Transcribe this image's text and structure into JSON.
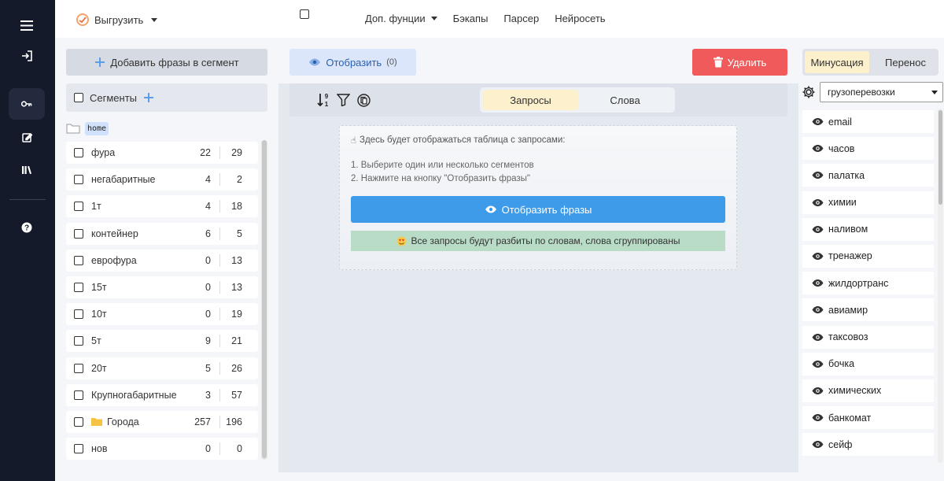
{
  "header": {
    "export_label": "Выгрузить",
    "nav": [
      "Доп. фунции",
      "Бэкапы",
      "Парсер",
      "Нейросеть"
    ]
  },
  "left": {
    "add_button": "Добавить фразы в сегмент",
    "segments_label": "Сегменты",
    "folder_tag": "home",
    "segments": [
      {
        "name": "фура",
        "a": "22",
        "b": "29",
        "folder": false
      },
      {
        "name": "негабаритные",
        "a": "4",
        "b": "2",
        "folder": false
      },
      {
        "name": "1т",
        "a": "4",
        "b": "18",
        "folder": false
      },
      {
        "name": "контейнер",
        "a": "6",
        "b": "5",
        "folder": false
      },
      {
        "name": "еврофура",
        "a": "0",
        "b": "13",
        "folder": false
      },
      {
        "name": "15т",
        "a": "0",
        "b": "13",
        "folder": false
      },
      {
        "name": "10т",
        "a": "0",
        "b": "19",
        "folder": false
      },
      {
        "name": "5т",
        "a": "9",
        "b": "21",
        "folder": false
      },
      {
        "name": "20т",
        "a": "5",
        "b": "26",
        "folder": false
      },
      {
        "name": "Крупногабаритные",
        "a": "3",
        "b": "57",
        "folder": false
      },
      {
        "name": "Города",
        "a": "257",
        "b": "196",
        "folder": true
      },
      {
        "name": "нов",
        "a": "0",
        "b": "0",
        "folder": false
      }
    ]
  },
  "middle": {
    "show_button": "Отобразить",
    "show_count": "(0)",
    "delete_button": "Удалить",
    "tabs": [
      "Запросы",
      "Слова"
    ],
    "active_tab": 0,
    "info_title": "Здесь будет отображаться таблица с запросами:",
    "steps": [
      "1. Выберите один или несколько сегментов",
      "2. Нажмите на кнопку \"Отобразить фразы\""
    ],
    "show_phrases_button": "Отобразить фразы",
    "note": "Все запросы будут разбиты по словам, слова сгруппированы"
  },
  "right": {
    "tabs": [
      "Минусация",
      "Перенос"
    ],
    "active_tab": 0,
    "selected_list": "грузоперевозки",
    "words": [
      "email",
      "часов",
      "палатка",
      "химии",
      "наливом",
      "тренажер",
      "жилдортранс",
      "авиамир",
      "таксовоз",
      "бочка",
      "химических",
      "банкомат",
      "сейф"
    ]
  },
  "colors": {
    "rail": "#141a2a",
    "accent_blue": "#3d9be9",
    "danger": "#f05a5a",
    "active_tab": "#fdf0cd",
    "note_green": "#b9dcc6"
  }
}
